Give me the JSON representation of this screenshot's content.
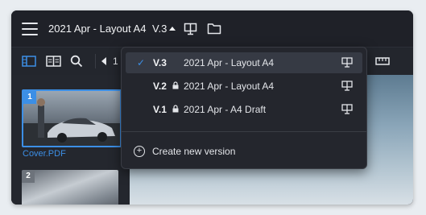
{
  "header": {
    "doc_title": "2021 Apr - Layout A4",
    "version": "V.3"
  },
  "sidebar": {
    "pages": [
      {
        "number": "1",
        "label": "Cover.PDF"
      },
      {
        "number": "2",
        "label": ""
      }
    ]
  },
  "toolbar": {
    "page_value": "1"
  },
  "version_menu": {
    "items": [
      {
        "version": "V.3",
        "title": "2021 Apr - Layout A4",
        "selected": true,
        "locked": false
      },
      {
        "version": "V.2",
        "title": "2021 Apr - Layout A4",
        "selected": false,
        "locked": true
      },
      {
        "version": "V.1",
        "title": "2021 Apr - A4 Draft",
        "selected": false,
        "locked": true
      }
    ],
    "create_label": "Create new version"
  },
  "colors": {
    "accent": "#3c8fe6",
    "window_bg": "#1b1d23",
    "menu_bg": "#24262d"
  },
  "icons": [
    "hamburger-icon",
    "presentation-icon",
    "folder-icon",
    "grid-view-icon",
    "two-page-icon",
    "search-icon",
    "chevron-left-icon",
    "ruler-icon",
    "check-icon",
    "lock-icon",
    "plus-circle-icon"
  ]
}
